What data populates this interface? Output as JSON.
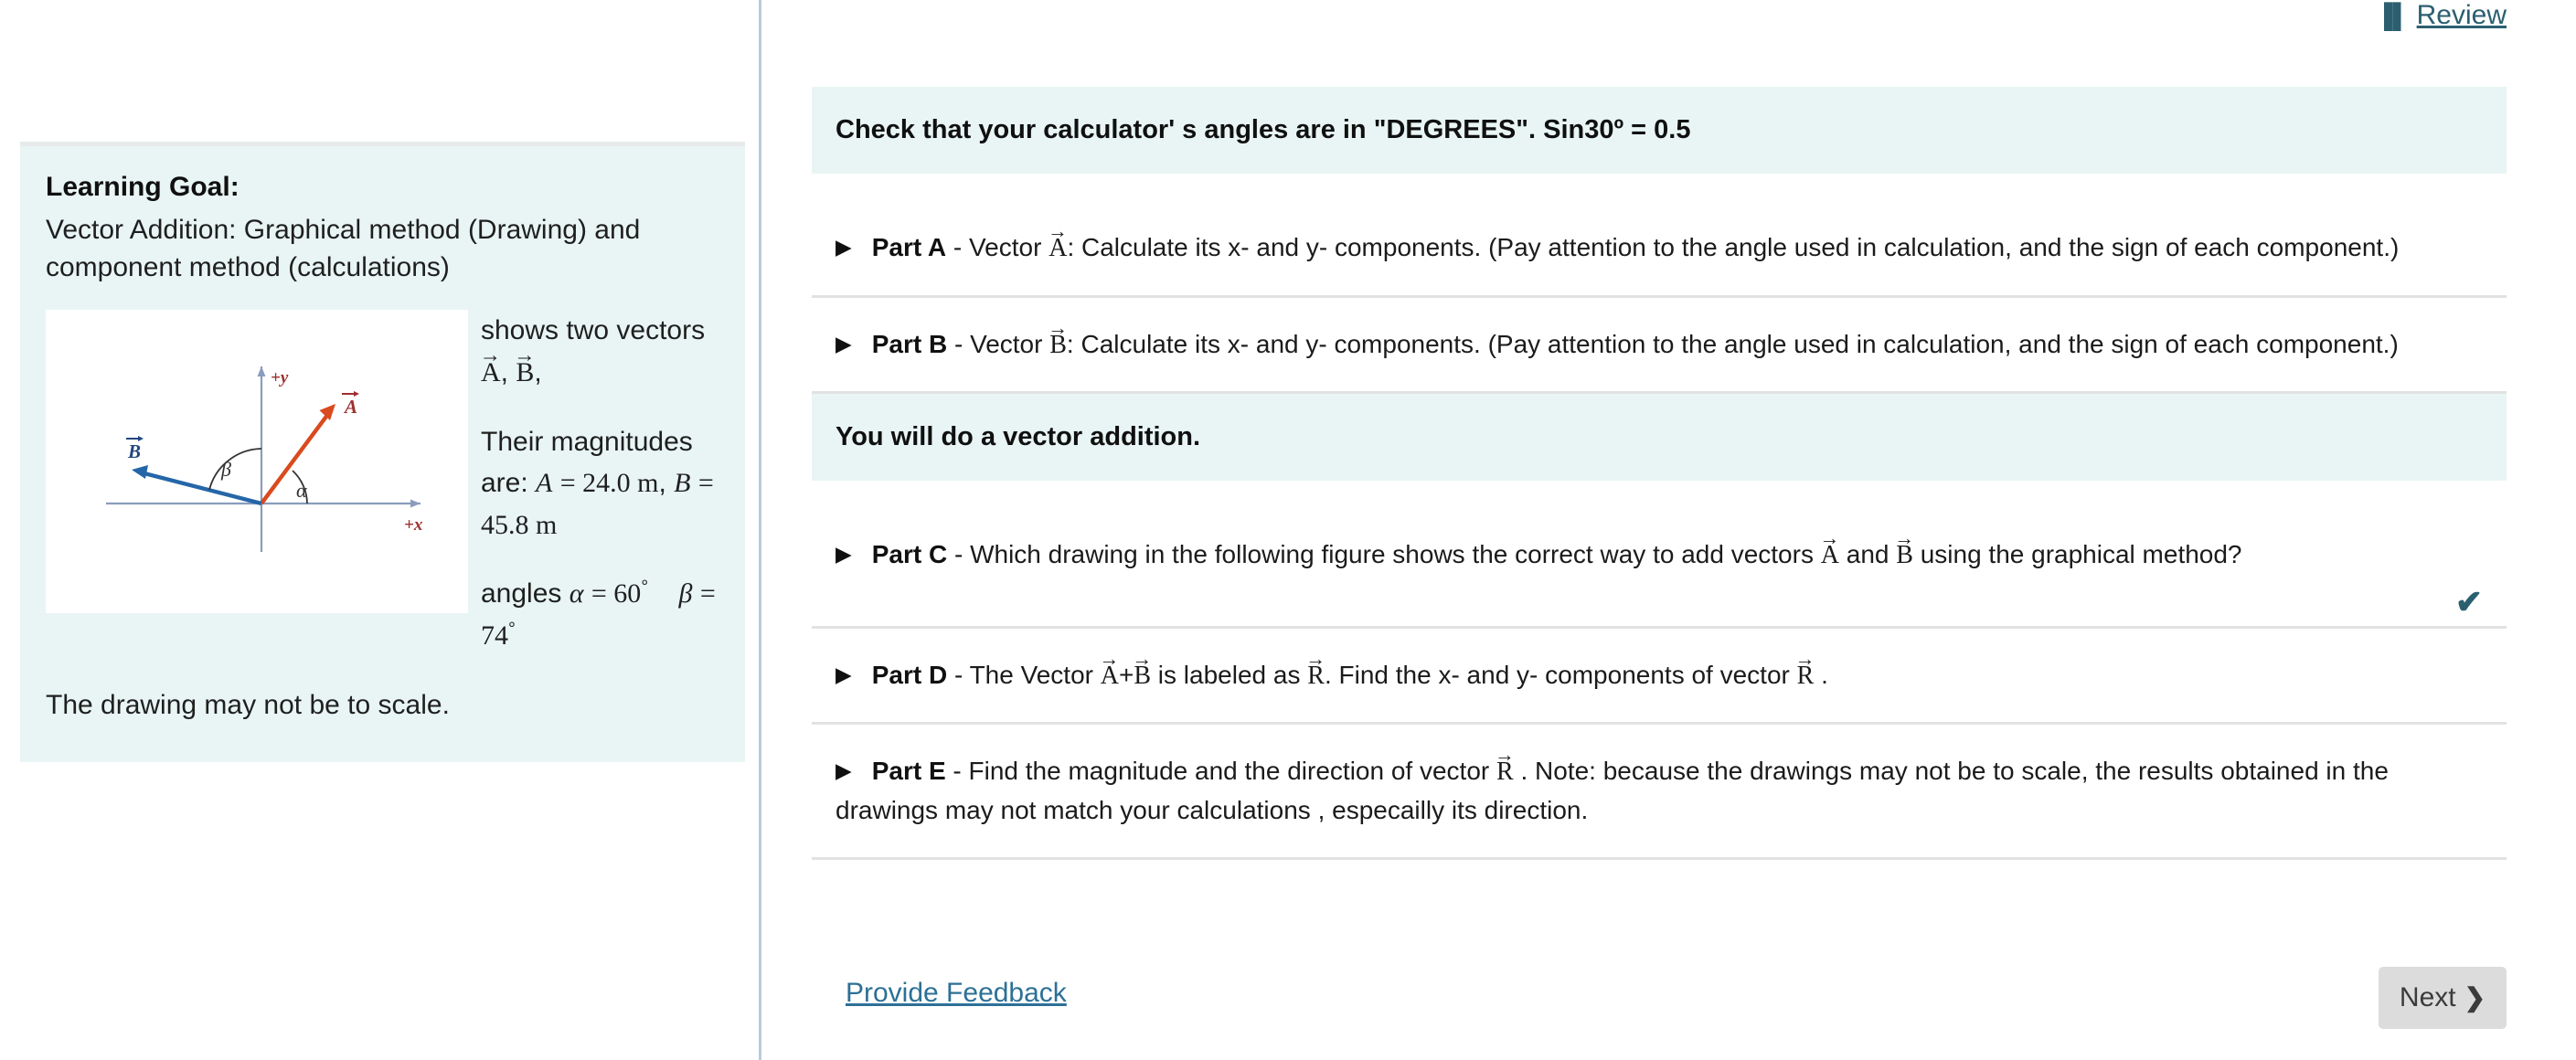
{
  "review": {
    "icon": "book-icon",
    "glyph": "▐▌",
    "label": "Review",
    "color": "#2b5f70"
  },
  "left_panel": {
    "goal_title": "Learning Goal:",
    "goal_subtitle": "Vector Addition: Graphical method (Drawing)  and component method (calculations)",
    "figure": {
      "name": "vector-diagram",
      "axis_label_x": "+x",
      "axis_label_y": "+y",
      "vector_a_label": "A",
      "vector_b_label": "B",
      "angle_alpha_label": "α",
      "angle_beta_label": "β",
      "vector_a_color": "#d94a1e",
      "vector_b_color": "#2566a8",
      "axis_color": "#8a9dbd",
      "label_color": "#9e2f2f"
    },
    "caption_prefix": "shows two vectors ",
    "caption_vec_a": "A",
    "caption_comma1": ",",
    "caption_vec_b": "B",
    "caption_comma2": ",",
    "magnitudes_prefix": "Their magnitudes are: ",
    "magnitude_a_symbol": "A",
    "magnitude_a_value": "= 24.0 m",
    "magnitude_sep": ",",
    "magnitude_b_symbol": "B",
    "magnitude_b_value": "= 45.8 m",
    "angles_prefix": "angles ",
    "alpha_symbol": "α",
    "alpha_value": "= 60",
    "alpha_degree": "°",
    "beta_symbol": "β",
    "beta_value": "= 74",
    "beta_degree": "°",
    "scale_note": "The drawing may not be to scale."
  },
  "banners": {
    "calculator_note": "Check that your calculator' s angles are in \"DEGREES\". Sin30º = 0.5",
    "vector_addition_note": "You will do a vector addition."
  },
  "parts": {
    "a": {
      "marker": "▶",
      "label": "Part A",
      "dash": " - ",
      "text_before": "Vector ",
      "vec": "A",
      "text_after": ": Calculate its x- and y- components. (Pay attention to the angle used in calculation, and the sign of each component.)"
    },
    "b": {
      "marker": "▶",
      "label": "Part B",
      "dash": " - ",
      "text_before": "Vector ",
      "vec": "B",
      "text_after": ": Calculate its x- and y- components. (Pay attention to the angle used in calculation, and the sign of each component.)"
    },
    "c": {
      "marker": "▶",
      "label": "Part C",
      "dash": " - ",
      "text_before": "Which drawing in the following figure shows the correct way to add vectors ",
      "vec1": "A",
      "text_mid": " and ",
      "vec2": "B",
      "text_after": " using the graphical method?",
      "answered_check": "✔"
    },
    "d": {
      "marker": "▶",
      "label": "Part D",
      "dash": " - ",
      "text_before": "The Vector ",
      "vec1": "A",
      "plus": "+",
      "vec2": "B",
      "text_mid": " is labeled as ",
      "vec3": "R",
      "text_mid2": ". Find the  x- and y- components of vector ",
      "vec4": "R",
      "text_after": " ."
    },
    "e": {
      "marker": "▶",
      "label": "Part E",
      "dash": " - ",
      "text_before": "Find the magnitude and the direction of vector ",
      "vec": "R",
      "text_after": " . Note: because the drawings may not be to scale, the results obtained in the drawings may not match your calculations , especailly its direction."
    }
  },
  "footer": {
    "feedback_label": "Provide Feedback",
    "next_label": "Next",
    "next_chevron": "❯"
  }
}
